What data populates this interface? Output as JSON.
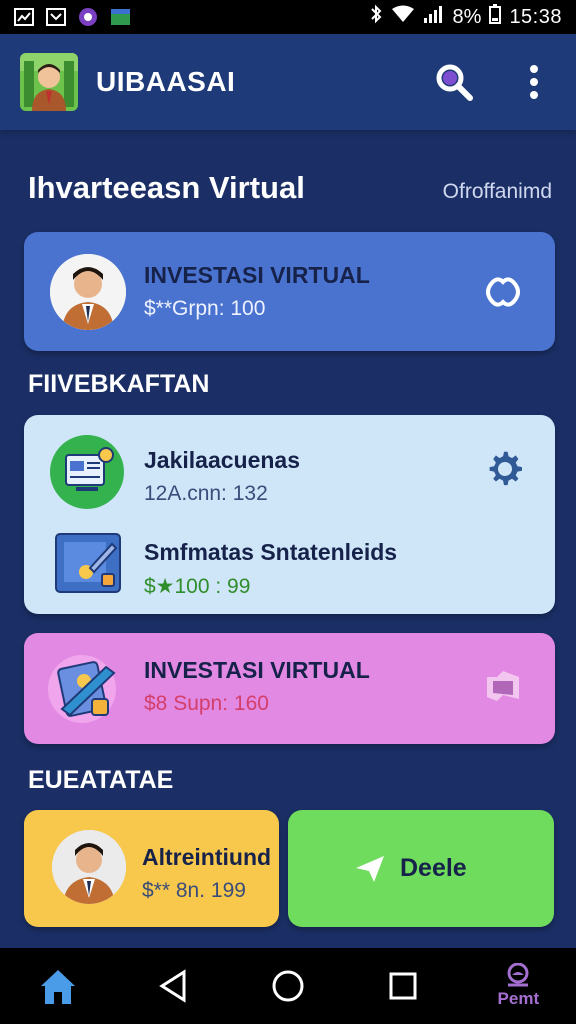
{
  "status_bar": {
    "battery": "8%",
    "time": "15:38"
  },
  "app_bar": {
    "title": "UIBAASAI",
    "search_icon": "search-icon",
    "menu_icon": "more-vert-icon"
  },
  "page": {
    "title": "Ihvarteeasn Virtual",
    "meta": "Ofroffanimd"
  },
  "hero_card": {
    "title": "INVESTASI VIRTUAL",
    "subtitle": "$**Grpn: 100",
    "action_icon": "badge-icon"
  },
  "section_1": {
    "title": "FIIVEBKAFTAN"
  },
  "list_card": {
    "items": [
      {
        "title": "Jakilaacuenas",
        "subtitle": "12A.cnn: 132",
        "icon": "document-icon",
        "action_icon": "gear-icon"
      },
      {
        "title": "Smfmatas Sntatenleids",
        "subtitle": "$★100 : 99",
        "icon": "tablet-pen-icon"
      }
    ]
  },
  "pink_card": {
    "title": "INVESTASI VIRTUAL",
    "subtitle": "$8 Supn: 160",
    "icon": "tablet-pencil-icon",
    "action_icon": "flag-icon"
  },
  "section_2": {
    "title": "EUEATATAE"
  },
  "yellow_card": {
    "title": "Altreintiund",
    "subtitle": "$** 8n. 199"
  },
  "green_card": {
    "label": "Deele",
    "icon": "send-icon"
  },
  "nav": {
    "home_icon": "home-icon",
    "back_icon": "back-icon",
    "circle_icon": "home-circle-icon",
    "square_icon": "recents-icon",
    "profile_label": "Pemt"
  },
  "colors": {
    "background": "#1b2f66",
    "app_bar": "#1f3a78",
    "hero_card": "#4a73cf",
    "list_card": "#cfe5f8",
    "pink_card": "#e289e3",
    "yellow_card": "#f7c84c",
    "green_card": "#6fdc5e",
    "accent_purple": "#a46fd0"
  }
}
